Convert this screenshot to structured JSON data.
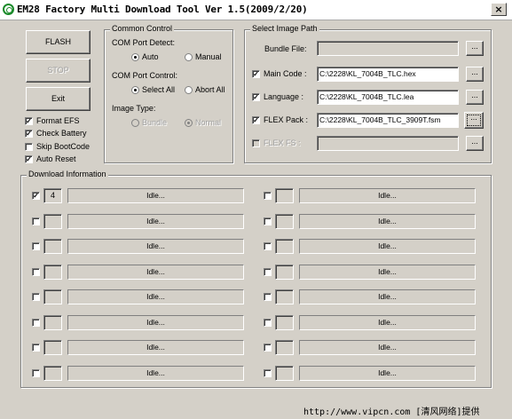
{
  "window": {
    "title": "EM28 Factory Multi Download Tool Ver 1.5(2009/2/20)",
    "close_glyph": "×"
  },
  "buttons": {
    "flash": "FLASH",
    "stop": "STOP",
    "exit": "Exit"
  },
  "options": [
    {
      "label": "Format EFS",
      "checked": true
    },
    {
      "label": "Check Battery",
      "checked": true
    },
    {
      "label": "Skip BootCode",
      "checked": false
    },
    {
      "label": "Auto Reset",
      "checked": true
    }
  ],
  "common_control": {
    "title": "Common Control",
    "com_detect_label": "COM Port Detect:",
    "detect_auto": "Auto",
    "detect_manual": "Manual",
    "detect_selected": "Auto",
    "com_control_label": "COM Port Control:",
    "control_select_all": "Select All",
    "control_abort_all": "Abort All",
    "control_selected": "Select All",
    "image_type_label": "Image Type:",
    "type_bundle": "Bundle",
    "type_normal": "Normal",
    "type_selected": "Normal"
  },
  "image_path": {
    "title": "Select Image Path",
    "bundle_label": "Bundle File:",
    "bundle_value": "",
    "main_label": "Main Code :",
    "main_value": "C:\\2228\\KL_7004B_TLC.hex",
    "language_label": "Language :",
    "language_value": "C:\\2228\\KL_7004B_TLC.lea",
    "flex_pack_label": "FLEX Pack :",
    "flex_pack_value": "C:\\2228\\KL_7004B_TLC_3909T.fsm",
    "flex_fs_label": "FLEX FS :",
    "flex_fs_value": "",
    "browse_label": "..."
  },
  "download_info": {
    "title": "Download Information",
    "ports": [
      {
        "checked": true,
        "port": "4",
        "status": "Idle..."
      },
      {
        "checked": false,
        "port": "",
        "status": "Idle..."
      },
      {
        "checked": false,
        "port": "",
        "status": "Idle..."
      },
      {
        "checked": false,
        "port": "",
        "status": "Idle..."
      },
      {
        "checked": false,
        "port": "",
        "status": "Idle..."
      },
      {
        "checked": false,
        "port": "",
        "status": "Idle..."
      },
      {
        "checked": false,
        "port": "",
        "status": "Idle..."
      },
      {
        "checked": false,
        "port": "",
        "status": "Idle..."
      },
      {
        "checked": false,
        "port": "",
        "status": "Idle..."
      },
      {
        "checked": false,
        "port": "",
        "status": "Idle..."
      },
      {
        "checked": false,
        "port": "",
        "status": "Idle..."
      },
      {
        "checked": false,
        "port": "",
        "status": "Idle..."
      },
      {
        "checked": false,
        "port": "",
        "status": "Idle..."
      },
      {
        "checked": false,
        "port": "",
        "status": "Idle..."
      },
      {
        "checked": false,
        "port": "",
        "status": "Idle..."
      },
      {
        "checked": false,
        "port": "",
        "status": "Idle..."
      }
    ]
  },
  "watermark": "http://www.vipcn.com [清风网络]提供",
  "check_glyph": "✓"
}
